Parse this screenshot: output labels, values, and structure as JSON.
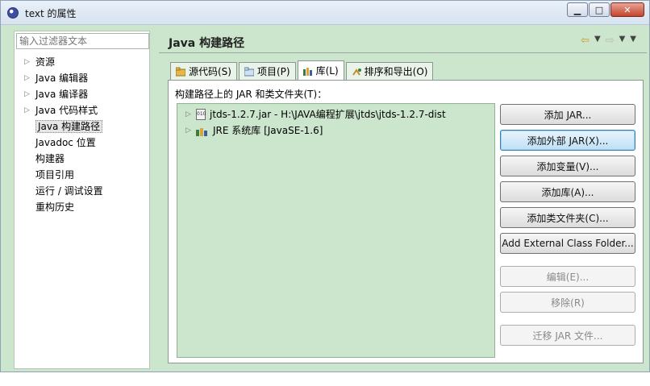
{
  "window": {
    "title": "text 的属性",
    "min_label": "▭",
    "max_label": "□",
    "close_label": "✕"
  },
  "left": {
    "filter_placeholder": "输入过滤器文本",
    "items": [
      {
        "label": "资源",
        "expandable": true
      },
      {
        "label": "Java 编辑器",
        "expandable": true
      },
      {
        "label": "Java 编译器",
        "expandable": true
      },
      {
        "label": "Java 代码样式",
        "expandable": true
      },
      {
        "label": "Java 构建路径",
        "expandable": false,
        "selected": true
      },
      {
        "label": "Javadoc 位置",
        "expandable": false
      },
      {
        "label": "构建器",
        "expandable": false
      },
      {
        "label": "项目引用",
        "expandable": false
      },
      {
        "label": "运行 / 调试设置",
        "expandable": false
      },
      {
        "label": "重构历史",
        "expandable": false
      }
    ]
  },
  "right": {
    "title": "Java 构建路径",
    "tabs": [
      {
        "label": "源代码(S)",
        "icon": "source-folder-icon"
      },
      {
        "label": "项目(P)",
        "icon": "project-folder-icon"
      },
      {
        "label": "库(L)",
        "icon": "library-icon",
        "active": true
      },
      {
        "label": "排序和导出(O)",
        "icon": "order-export-icon"
      }
    ],
    "list_label": "构建路径上的 JAR 和类文件夹(T)：",
    "entries": [
      {
        "label": "jtds-1.2.7.jar  -  H:\\JAVA编程扩展\\jtds\\jtds-1.2.7-dist",
        "icon": "jar-icon"
      },
      {
        "label": "JRE 系统库 [JavaSE-1.6]",
        "icon": "library-icon"
      }
    ],
    "buttons": {
      "add_jar": "添加 JAR...",
      "add_external_jar": "添加外部 JAR(X)...",
      "add_variable": "添加变量(V)...",
      "add_library": "添加库(A)...",
      "add_class_folder": "添加类文件夹(C)...",
      "add_external_class_folder": "Add External Class Folder...",
      "edit": "编辑(E)...",
      "remove": "移除(R)",
      "migrate_jar": "迁移 JAR 文件..."
    }
  },
  "colors": {
    "accent": "#cbe6cc",
    "focus": "#3c7fb1"
  }
}
